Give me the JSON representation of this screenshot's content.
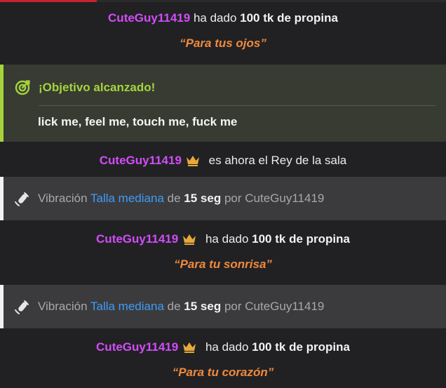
{
  "feed": {
    "tip1": {
      "user": "CuteGuy11419",
      "verb": "ha dado",
      "amount": "100 tk de propina",
      "message": "“Para tus ojos”"
    },
    "goal": {
      "title": "¡Objetivo alcanzado!",
      "text": "lick me, feel me, touch me, fuck me"
    },
    "king": {
      "user": "CuteGuy11419",
      "text": "es ahora el Rey de la sala"
    },
    "vib1": {
      "label": "Vibración",
      "level": "Talla mediana",
      "of": "de",
      "duration": "15 seg",
      "by": "por CuteGuy11419"
    },
    "tip2": {
      "user": "CuteGuy11419",
      "verb": "ha dado",
      "amount": "100 tk de propina",
      "message": "“Para tu sonrisa”"
    },
    "vib2": {
      "label": "Vibración",
      "level": "Talla mediana",
      "of": "de",
      "duration": "15 seg",
      "by": "por CuteGuy11419"
    },
    "tip3": {
      "user": "CuteGuy11419",
      "verb": "ha dado",
      "amount": "100 tk de propina",
      "message": "“Para tu corazón”"
    }
  },
  "colors": {
    "username": "#d24df7",
    "goal_accent": "#a6d33c",
    "tip_message": "#f08a3c",
    "vibration_level": "#3f9cf5",
    "crown": "#e8a93c"
  },
  "icons": [
    "crown-icon",
    "target-goal-icon",
    "vibration-icon"
  ]
}
